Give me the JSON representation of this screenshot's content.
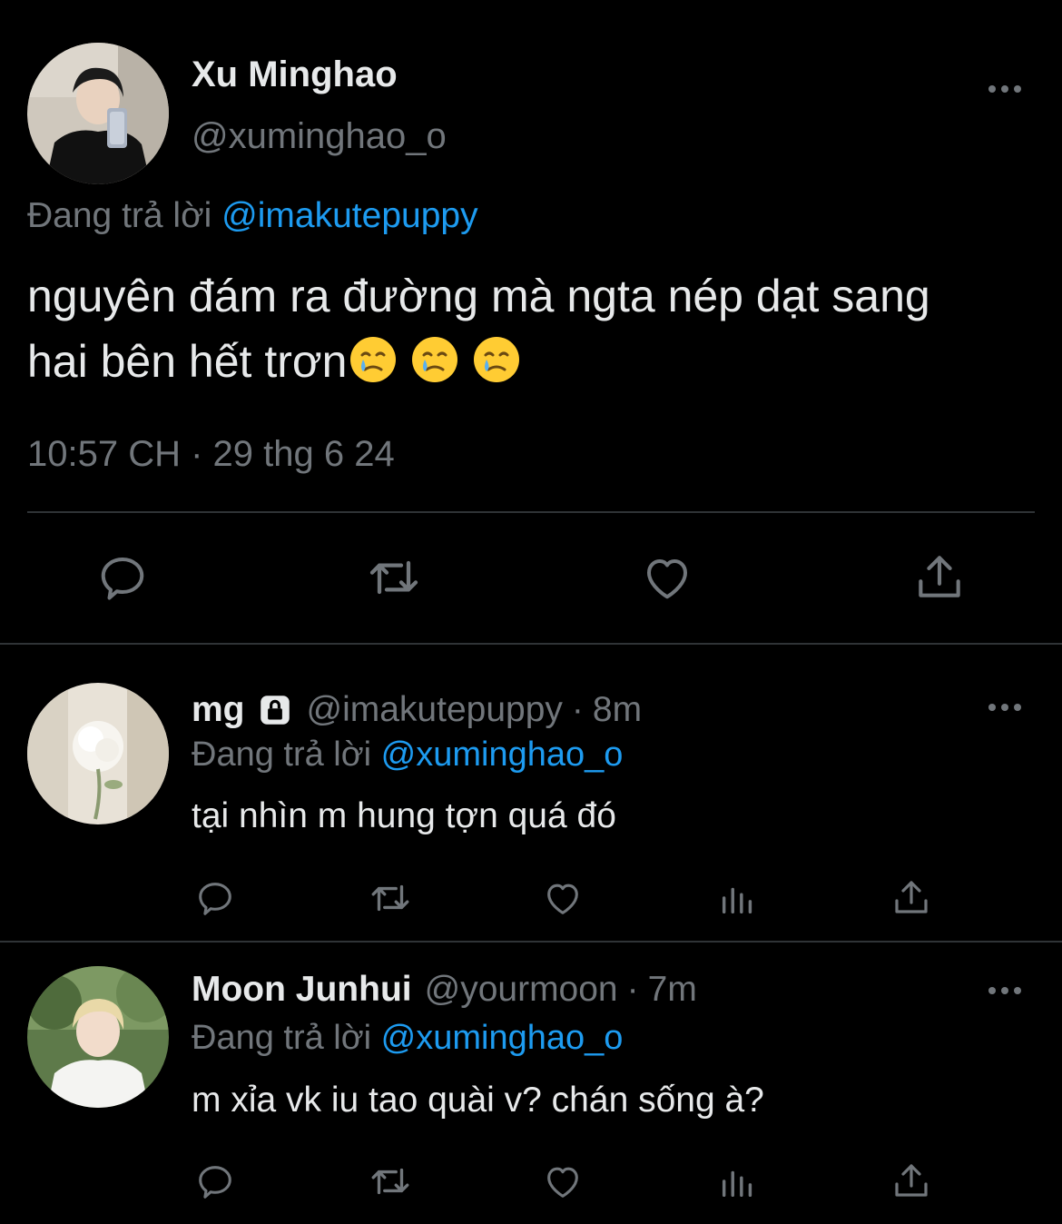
{
  "main_tweet": {
    "display_name": "Xu Minghao",
    "handle": "@xuminghao_o",
    "replying_prefix": "Đang trả lời",
    "replying_to": "@imakutepuppy",
    "text_line1": "nguyên đám ra đường mà ngta nép dạt sang",
    "text_line2": "hai bên hết trơn",
    "emojis": [
      "face-holding-back-tears",
      "face-holding-back-tears",
      "face-holding-back-tears"
    ],
    "timestamp": "10:57 CH · 29 thg 6 24",
    "actions": [
      "reply-icon",
      "retweet-icon",
      "like-icon",
      "share-icon"
    ]
  },
  "replies": [
    {
      "display_name": "mg",
      "locked": true,
      "handle": "@imakutepuppy",
      "separator": "·",
      "time": "8m",
      "replying_prefix": "Đang trả lời",
      "replying_to": "@xuminghao_o",
      "text": "tại nhìn m hung tợn quá đó"
    },
    {
      "display_name": "Moon Junhui",
      "locked": false,
      "handle": "@yourmoon",
      "separator": "·",
      "time": "7m",
      "replying_prefix": "Đang trả lời",
      "replying_to": "@xuminghao_o",
      "text": "m xỉa vk iu tao quài v? chán sống à?"
    }
  ],
  "colors": {
    "background": "#000000",
    "text": "#e7e9ea",
    "muted": "#71767b",
    "link": "#1d9bf0",
    "divider": "#2f3336"
  }
}
